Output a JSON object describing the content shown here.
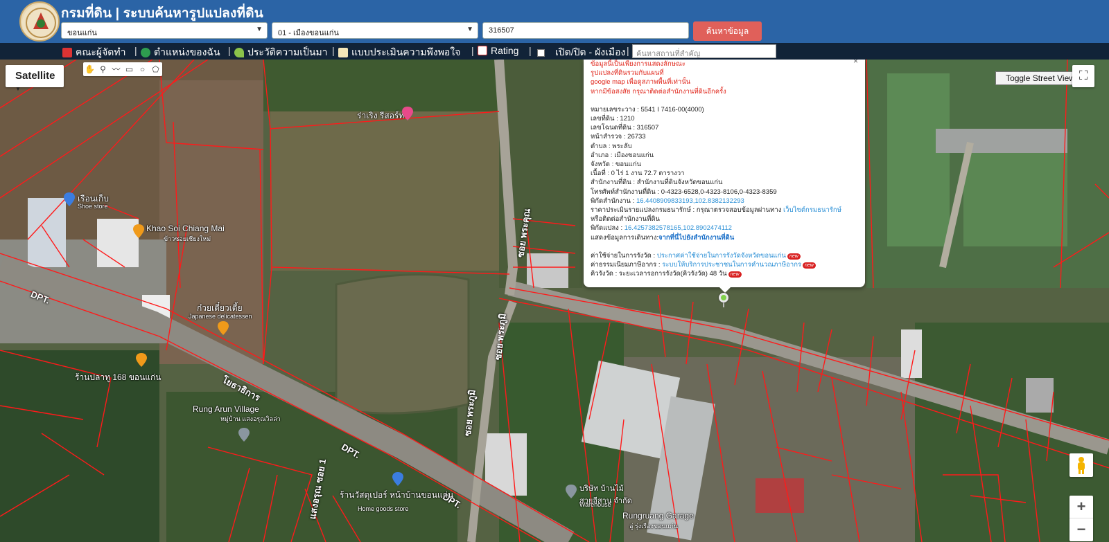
{
  "header": {
    "title": "กรมที่ดิน | ระบบค้นหารูปแปลงที่ดิน",
    "province_select": "ขอนแก่น",
    "district_select": "01 - เมืองขอนแก่น",
    "parcel_number": "316507",
    "search_button": "ค้นหาข้อมูล"
  },
  "navbar": {
    "items": [
      "คณะผู้จัดทำ",
      "ตำแหน่งของฉัน",
      "ประวัติความเป็นมา",
      "แบบประเมินความพึงพอใจ",
      "Rating"
    ],
    "toggle_label": "เปิด/ปิด - ผังเมือง",
    "separator": "|",
    "place_search_placeholder": "ค้นหาสถานที่สำคัญ"
  },
  "map": {
    "map_type": "Satellite",
    "street_view_toggle": "Toggle Street View",
    "zoom_in": "+",
    "zoom_out": "−",
    "labels": {
      "shoe_store_th": "เรือนเก็บ",
      "shoe_store_en": "Shoe store",
      "resort": "ร่าเริง รีสอร์ท",
      "khao_soi": "Khao Soi Chiang Mai",
      "khao_soi_th": "ข้าวซอยเชียงใหม่",
      "japanese_th": "ก๋วยเตี๋ยวเตี้ย",
      "japanese_en": "Japanese delicatessen",
      "restaurant": "ร้านปลาทู 168 ขอนแก่น",
      "road_obuthan": "โยธาธิการ",
      "rung_arun": "Rung Arun Village",
      "rung_arun_th": "หมู่บ้าน แสงอรุณวิลล่า",
      "dpt": "DPT.",
      "soi_phrakun": "ซอย พระคุณ",
      "soi_phrakhu": "ซอย พระภูมิ",
      "soi_arun": "แสงอรุณ ซอย 1",
      "supply_store": "ร้านวัสดุเปอร์ หน้าบ้านขอนแก่น",
      "home_goods": "Home goods store",
      "company": "บริษัท บ้านไม้ สวยอีสาน จำกัด",
      "warehouse": "Warehouse",
      "garage": "Rungruang Garage",
      "garage_th": "อู่ รุ่งเรืองขอนแก่น"
    }
  },
  "info": {
    "disclaimer": [
      "ข้อมูลนี้เป็นเพียงการแสดงลักษณะ",
      "รูปแปลงที่ดินรวมกับแผนที่",
      "google map เพื่อดูสภาพพื้นที่เท่านั้น",
      "หากมีข้อสงสัย กรุณาติดต่อสำนักงานที่ดินอีกครั้ง"
    ],
    "rows": [
      {
        "k": "หมายเลขระวาง",
        "v": "5541 I 7416-00(4000)"
      },
      {
        "k": "เลขที่ดิน",
        "v": "1210"
      },
      {
        "k": "เลขโฉนดที่ดิน",
        "v": "316507"
      },
      {
        "k": "หน้าสำรวจ",
        "v": "26733"
      },
      {
        "k": "ตำบล",
        "v": "พระลับ"
      },
      {
        "k": "อำเภอ",
        "v": "เมืองขอนแก่น"
      },
      {
        "k": "จังหวัด",
        "v": "ขอนแก่น"
      },
      {
        "k": "เนื้อที่",
        "v": "0 ไร่ 1 งาน 72.7 ตารางวา"
      },
      {
        "k": "สำนักงานที่ดิน",
        "v": "สำนักงานที่ดินจังหวัดขอนแก่น"
      },
      {
        "k": "โทรศัพท์สำนักงานที่ดิน",
        "v": "0-4323-6528,0-4323-8106,0-4323-8359"
      }
    ],
    "office_coord_label": "พิกัดสำนักงาน",
    "office_coord": "16.4408909833193,102.8382132293",
    "appraisal_label": "ราคาประเมินรายแปลงกรมธนารักษ์",
    "appraisal_text": "กรุณาตรวจสอบข้อมูลผ่านทาง",
    "appraisal_link": "เว็บไซต์กรมธนารักษ์",
    "appraisal_text2": "หรือติดต่อสำนักงานที่ดิน",
    "parcel_coord_label": "พิกัดแปลง",
    "parcel_coord": "16.4257382578165,102.8902474112",
    "route_label": "แสดงข้อมูลการเดินทาง:",
    "route_link": "จากที่นี่ไปยังสำนักงานที่ดิน",
    "fee_label": "ค่าใช้จ่ายในการรังวัด",
    "fee_link": "ประกาศค่าใช้จ่ายในการรังวัดจังหวัดขอนแก่น",
    "tax_label": "ค่าธรรมเนียมภาษีอากร",
    "tax_link": "ระบบให้บริการประชาชนในการคำนวณภาษีอากร",
    "queue_label": "คิวรังวัด",
    "queue_text": "ระยะเวลารอการรังวัด(คิวรังวัด) 48 วัน",
    "new_badge": "new",
    "sep": " : "
  }
}
